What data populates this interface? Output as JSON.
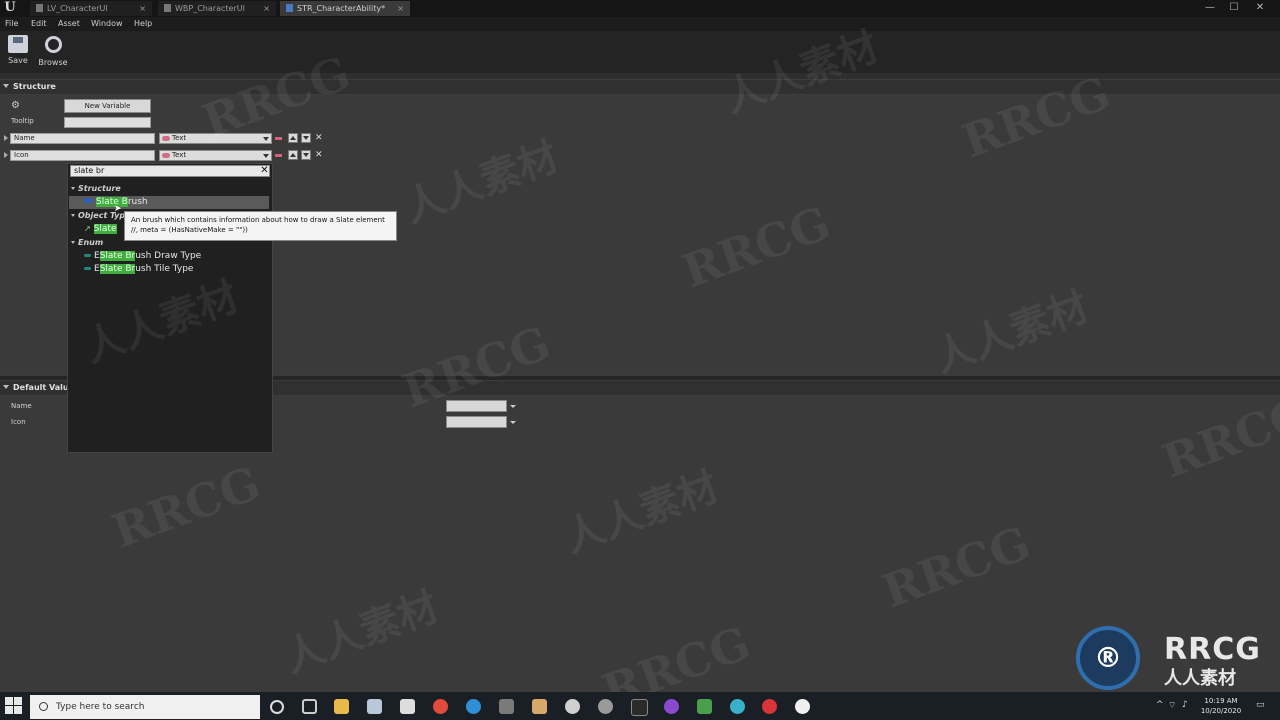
{
  "titlebar": {
    "tabs": [
      {
        "label": "LV_CharacterUI",
        "active": false
      },
      {
        "label": "WBP_CharacterUI",
        "active": false
      },
      {
        "label": "STR_CharacterAbility*",
        "active": true
      }
    ],
    "close_glyph": "×",
    "window_buttons": [
      "—",
      "☐",
      "✕"
    ]
  },
  "menu": [
    "File",
    "Edit",
    "Asset",
    "Window",
    "Help"
  ],
  "toolbar": {
    "save_label": "Save",
    "browse_label": "Browse"
  },
  "structure": {
    "header": "Structure",
    "new_variable_label": "New Variable",
    "tooltip_label": "Tooltip",
    "tooltip_value": "",
    "rows": [
      {
        "name": "Name",
        "type": "Text"
      },
      {
        "name": "Icon",
        "type": "Text"
      }
    ]
  },
  "type_picker": {
    "search_value": "slate br",
    "clear_glyph": "✕",
    "categories": [
      {
        "label": "Structure",
        "items": [
          {
            "pre": "",
            "hl": "Slate B",
            "post": "rush",
            "selected": true
          }
        ]
      },
      {
        "label": "Object Types",
        "items": [
          {
            "pre": "",
            "hl": "Slate",
            "post": "",
            "selected": false
          }
        ]
      },
      {
        "label": "Enum",
        "items": [
          {
            "pre": "E",
            "hl": "Slate Br",
            "post": "ush Draw Type",
            "selected": false
          },
          {
            "pre": "E",
            "hl": "Slate Br",
            "post": "ush Tile Type",
            "selected": false
          }
        ]
      }
    ],
    "tooltip_line1": "An brush which contains information about how to draw a Slate element",
    "tooltip_line2": "//, meta = (HasNativeMake = \"\"))"
  },
  "defaults": {
    "header": "Default Values",
    "rows": [
      {
        "name": "Name"
      },
      {
        "name": "Icon"
      }
    ]
  },
  "taskbar": {
    "search_placeholder": "Type here to search",
    "time": "10:19 AM",
    "date": "10/20/2020"
  },
  "watermark": {
    "text_latin": "RRCG",
    "text_cjk": "人人素材"
  },
  "colors": {
    "highlight": "#3fae3f",
    "text_type_pin": "#d46a86",
    "struct_pin": "#2f5fb8",
    "enum_pin": "#1f8a7a"
  }
}
